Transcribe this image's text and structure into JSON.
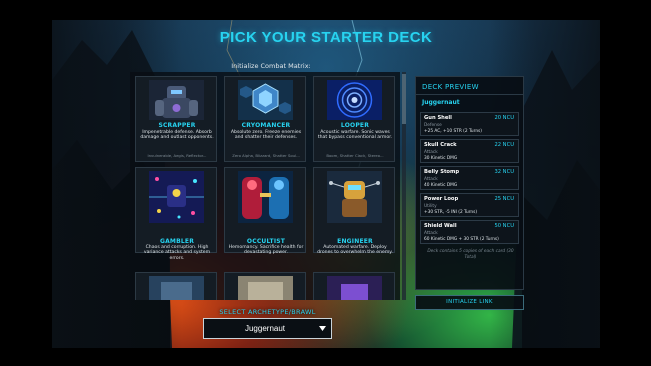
{
  "title": "PICK YOUR STARTER DECK",
  "subtitle": "Initialize Combat Matrix:",
  "archetypes": [
    {
      "name": "SCRAPPER",
      "desc": "Impenetrable defense. Absorb damage and outlast opponents.",
      "tags": "Invulnerable, Aegis, Reflector...",
      "icon": "armored-robot-icon"
    },
    {
      "name": "CRYOMANCER",
      "desc": "Absolute zero. Freeze enemies and shatter their defenses.",
      "tags": "Zero Alpha, Blizzard, Shatter Soul...",
      "icon": "ice-hexagon-icon"
    },
    {
      "name": "LOOPER",
      "desc": "Acoustic warfare. Sonic waves that bypass conventional armor.",
      "tags": "Boom, Shatter Clack, Stereo...",
      "icon": "sonic-wave-icon"
    },
    {
      "name": "GAMBLER",
      "desc": "Chaos and corruption. High variance attacks and system errors.",
      "tags": "BSOD, Blue Chip, Sugha Al...",
      "icon": "chaos-circuit-icon"
    },
    {
      "name": "OCCULTIST",
      "desc": "Hemomancy. Sacrifice health for devastating power.",
      "tags": "Exsanguinate, Flesh Hook, Sacrifice...",
      "icon": "blood-ritual-icon"
    },
    {
      "name": "ENGINEER",
      "desc": "Automated warfare. Deploy drones to overwhelm the enemy.",
      "tags": "Orbital Strike, Swarm, Bomb Drone...",
      "icon": "drone-icon"
    }
  ],
  "preview": {
    "heading": "DECK PREVIEW",
    "archetype": "Juggernaut",
    "cards": [
      {
        "name": "Gun Shell",
        "cost": "20 NCU",
        "type": "Defense",
        "effect": "+25 AC, +10 STR (2 Turns)"
      },
      {
        "name": "Skull Crack",
        "cost": "22 NCU",
        "type": "Attack",
        "effect": "30 Kinetic DMG"
      },
      {
        "name": "Belly Stomp",
        "cost": "32 NCU",
        "type": "Attack",
        "effect": "40 Kinetic DMG"
      },
      {
        "name": "Power Loop",
        "cost": "25 NCU",
        "type": "Utility",
        "effect": "+30 STR, -5 INI (2 Turns)"
      },
      {
        "name": "Shield Wall",
        "cost": "50 NCU",
        "type": "Attack",
        "effect": "60 Kinetic DMG + 30 STR (2 Turns)"
      }
    ],
    "note": "Deck contains 5 copies of each card (30 Total)"
  },
  "init_button": "INITIALIZE LINK",
  "select": {
    "label": "SELECT ARCHETYPE/BRAWL",
    "value": "Juggernaut"
  },
  "colors": {
    "accent": "#27d3f0",
    "panel": "#141c24",
    "panel_border": "#2c3944"
  }
}
